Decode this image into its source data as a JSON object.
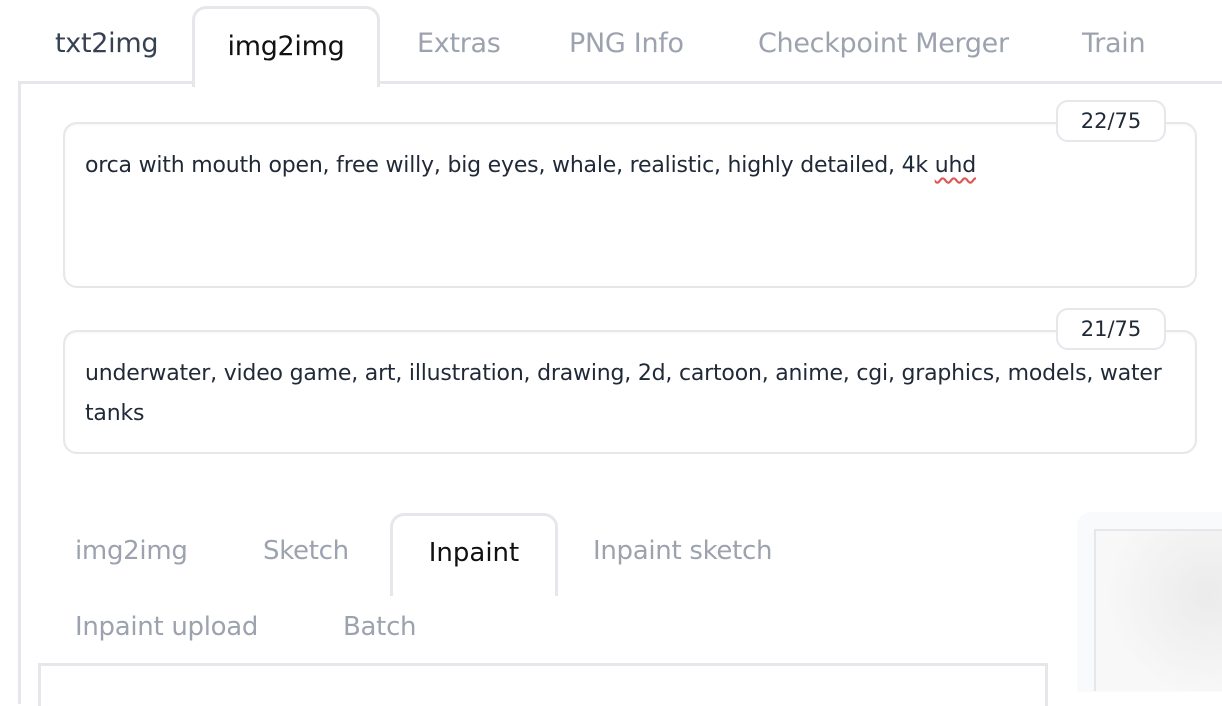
{
  "top_tabs": [
    {
      "label": "txt2img",
      "selected": false
    },
    {
      "label": "img2img",
      "selected": true
    },
    {
      "label": "Extras",
      "selected": false
    },
    {
      "label": "PNG Info",
      "selected": false
    },
    {
      "label": "Checkpoint Merger",
      "selected": false
    },
    {
      "label": "Train",
      "selected": false
    }
  ],
  "prompt": {
    "value": "orca with mouth open, free willy, big eyes, whale, realistic, highly detailed, 4k ",
    "misspelled": "uhd",
    "token_count": "22/75"
  },
  "negative_prompt": {
    "value": "underwater, video game, art, illustration, drawing, 2d, cartoon, anime, cgi, graphics, models, water tanks",
    "token_count": "21/75"
  },
  "sub_tabs": [
    {
      "label": "img2img",
      "selected": false
    },
    {
      "label": "Sketch",
      "selected": false
    },
    {
      "label": "Inpaint",
      "selected": true
    },
    {
      "label": "Inpaint sketch",
      "selected": false
    },
    {
      "label": "Inpaint upload",
      "selected": false
    },
    {
      "label": "Batch",
      "selected": false
    }
  ]
}
